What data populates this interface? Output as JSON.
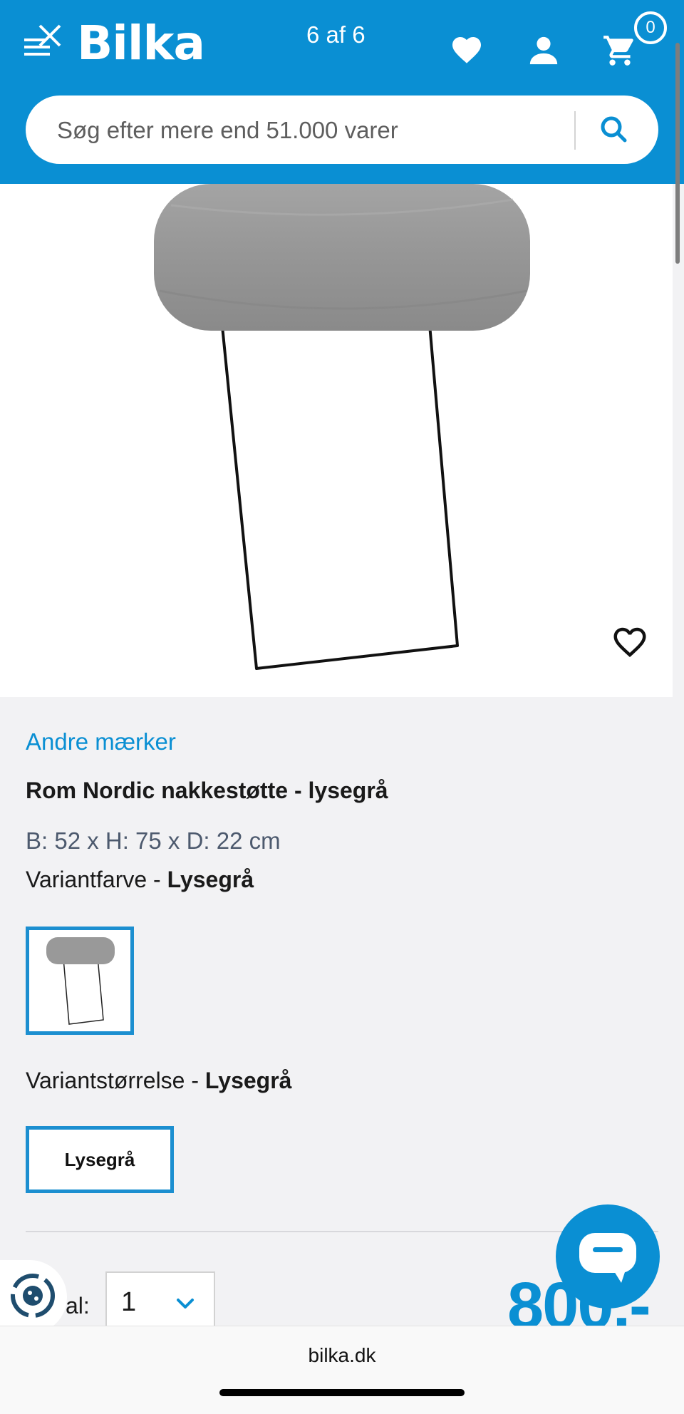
{
  "header": {
    "logo": "Bilka",
    "counter": "6 af 6",
    "cart_count": "0",
    "search_placeholder": "Søg efter mere end 51.000 varer"
  },
  "product": {
    "brand": "Andre mærker",
    "title": "Rom Nordic nakkestøtte - lysegrå",
    "dimensions": "B: 52 x H: 75 x D: 22 cm",
    "variant_color_label": "Variantfarve - ",
    "variant_color_value": "Lysegrå",
    "variant_size_label": "Variantstørrelse - ",
    "variant_size_value": "Lysegrå",
    "size_option": "Lysegrå",
    "quantity_label": "al:",
    "quantity_value": "1",
    "price": "800,-"
  },
  "browser": {
    "url": "bilka.dk"
  },
  "colors": {
    "brand_blue": "#0a8fd3",
    "selected_border": "#1c8fd0"
  }
}
